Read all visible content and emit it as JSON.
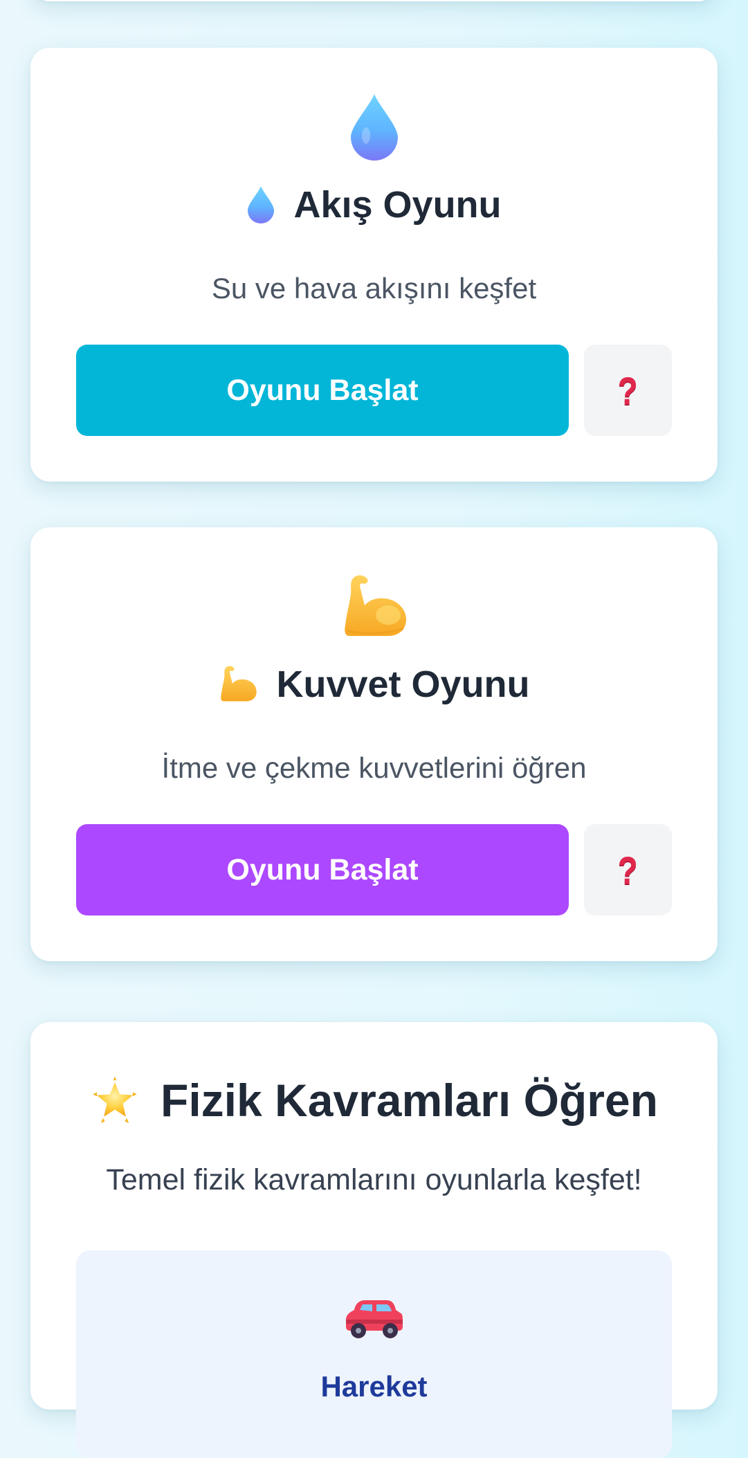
{
  "games": [
    {
      "id": "akis",
      "icon": "water-drop-icon",
      "title": "Akış Oyunu",
      "description": "Su ve hava akışını keşfet",
      "start_label": "Oyunu Başlat",
      "help_label": "?",
      "button_color": "#03b6d8"
    },
    {
      "id": "kuvvet",
      "icon": "flexed-biceps-icon",
      "title": "Kuvvet Oyunu",
      "description": "İtme ve çekme kuvvetlerini öğren",
      "start_label": "Oyunu Başlat",
      "help_label": "?",
      "button_color": "#ac48ff"
    }
  ],
  "concepts": {
    "icon": "glowing-star-icon",
    "title": "Fizik Kavramları Öğren",
    "subtitle": "Temel fizik kavramlarını oyunlarla keşfet!",
    "items": [
      {
        "icon": "car-icon",
        "label": "Hareket"
      }
    ]
  },
  "colors": {
    "text_dark": "#1f2937",
    "text_muted": "#4b5563",
    "help_bg": "#f3f4f6",
    "help_mark": "#e0284c",
    "concept_box_bg": "#eef4fd",
    "concept_label": "#1e3a9a"
  }
}
